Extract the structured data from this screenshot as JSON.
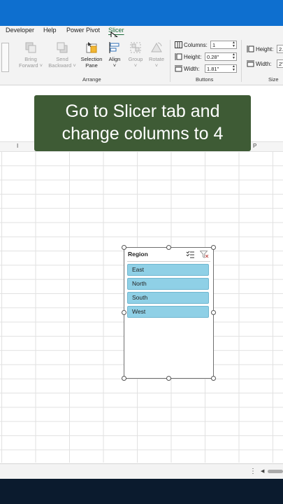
{
  "menu": {
    "items": [
      "Developer",
      "Help",
      "Power Pivot",
      "Slicer"
    ],
    "active": "Slicer"
  },
  "ribbon": {
    "arrange": {
      "bring_forward": [
        "Bring",
        "Forward"
      ],
      "send_backward": [
        "Send",
        "Backward"
      ],
      "selection_pane": [
        "Selection",
        "Pane"
      ],
      "align": "Align",
      "group": "Group",
      "rotate": "Rotate",
      "group_label": "Arrange"
    },
    "buttons": {
      "columns_label": "Columns:",
      "columns_value": "1",
      "height_label": "Height:",
      "height_value": "0.28\"",
      "width_label": "Width:",
      "width_value": "1.81\"",
      "group_label": "Buttons"
    },
    "size": {
      "height_label": "Height:",
      "height_value": "2.",
      "width_label": "Width:",
      "width_value": "2\"",
      "group_label": "Size"
    }
  },
  "columns": [
    "I",
    "P"
  ],
  "caption": {
    "line1": "Go to Slicer tab and",
    "line2": "change columns to 4"
  },
  "slicer": {
    "title": "Region",
    "items": [
      "East",
      "North",
      "South",
      "West"
    ],
    "item_color": "#8fd0e6"
  },
  "colors": {
    "topbar": "#0e6fcf",
    "caption_bg": "#3e5b35",
    "active_tab": "#1a6b39",
    "footer": "#0b1b2e"
  }
}
